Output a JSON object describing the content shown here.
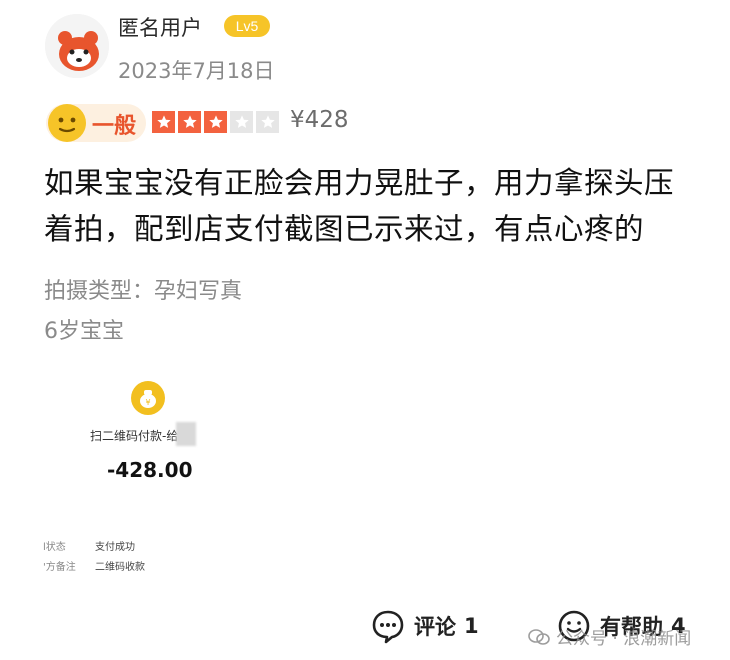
{
  "user": {
    "name": "匿名用户",
    "level": "Lv5",
    "date": "2023年7月18日"
  },
  "rating": {
    "label": "一般",
    "stars_filled": 3,
    "stars_total": 5,
    "price": "¥428"
  },
  "review": {
    "line1": "如果宝宝没有正脸会用力晃肚子，用力拿探头压",
    "line2": "着拍，配到店支付截图已示来过，有点心疼的"
  },
  "meta": {
    "shoot_type": "拍摄类型：孕妇写真",
    "tag": "6岁宝宝"
  },
  "payment": {
    "desc": "扫二维码付款-给",
    "amount": "-428.00",
    "status_key": "l状态",
    "status_value": "支付成功",
    "note_key": "'方备注",
    "note_value": "二维码收款"
  },
  "footer": {
    "comment_label": "评论",
    "comment_count": "1",
    "helpful_label": "有帮助",
    "helpful_count": "4"
  },
  "watermark": {
    "text": "公众号 · 浪潮新闻"
  },
  "colors": {
    "accent": "#f3623f",
    "badge": "#f6c428",
    "rating_text": "#e8552d"
  }
}
